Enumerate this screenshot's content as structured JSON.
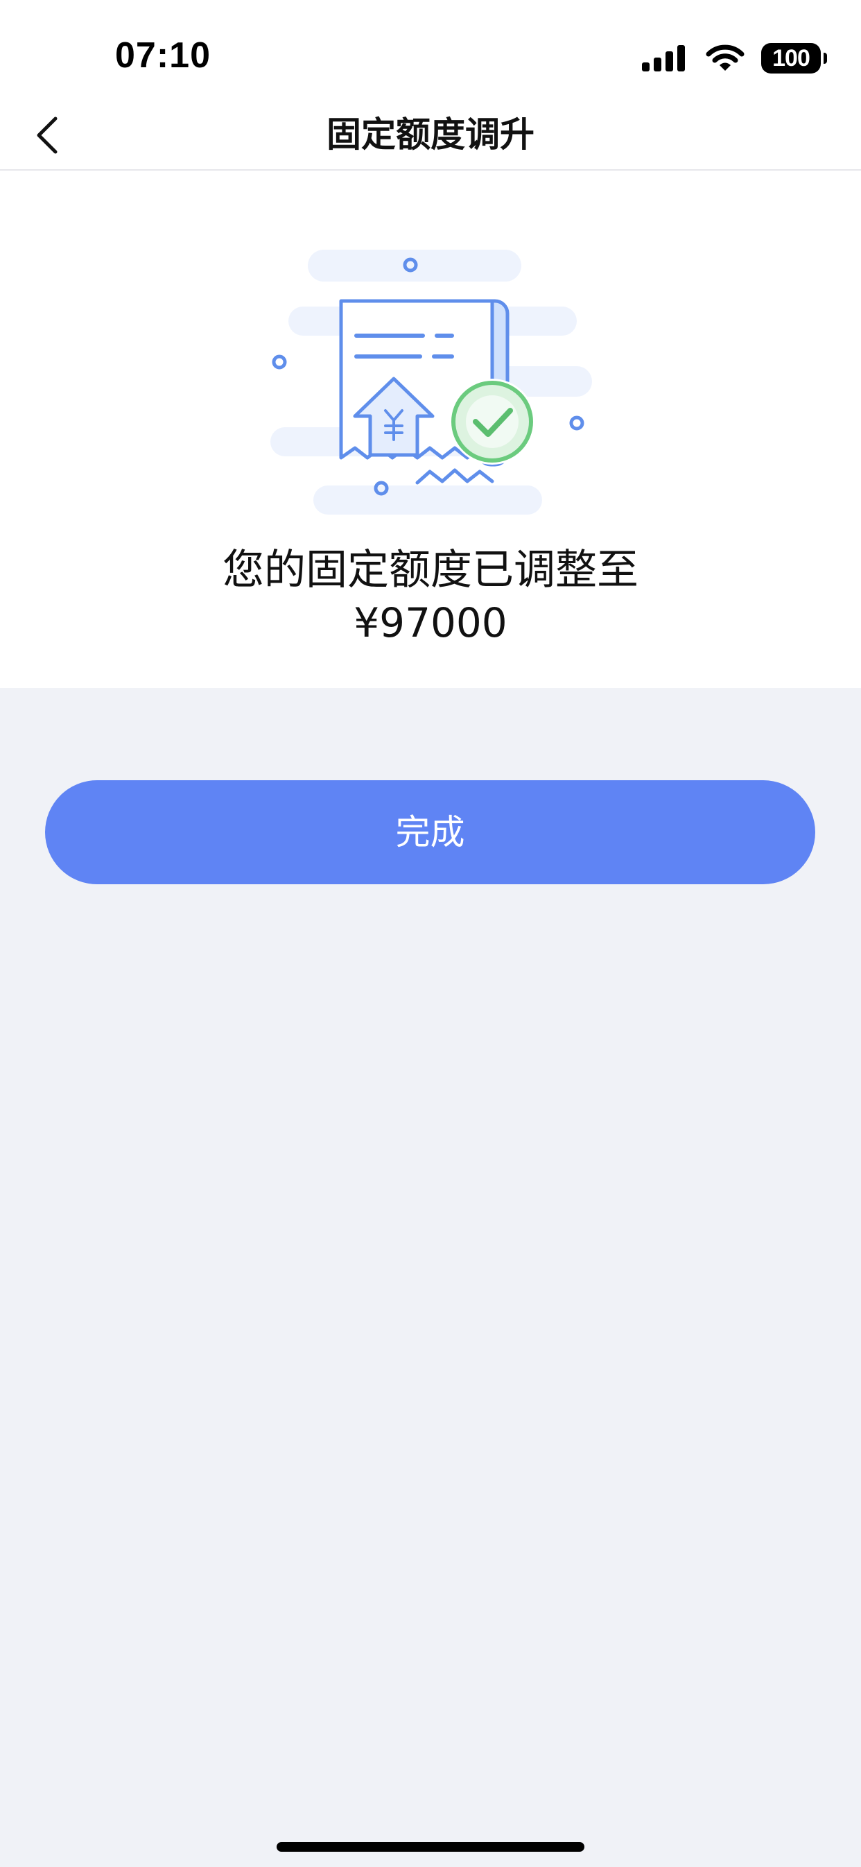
{
  "status_bar": {
    "time": "07:10",
    "battery_level": "100",
    "icons": [
      "signal-icon",
      "wifi-icon",
      "battery-icon"
    ]
  },
  "nav": {
    "back_icon": "chevron-left-icon",
    "title": "固定额度调升"
  },
  "result": {
    "illustration": "receipt-success-icon",
    "message": "您的固定额度已调整至",
    "amount": "¥97000"
  },
  "actions": {
    "done_label": "完成"
  },
  "colors": {
    "accent": "#5F84F4",
    "success": "#6BCB7E",
    "page_background": "#F0F2F7",
    "illustration_blue": "#5F8EEB"
  }
}
